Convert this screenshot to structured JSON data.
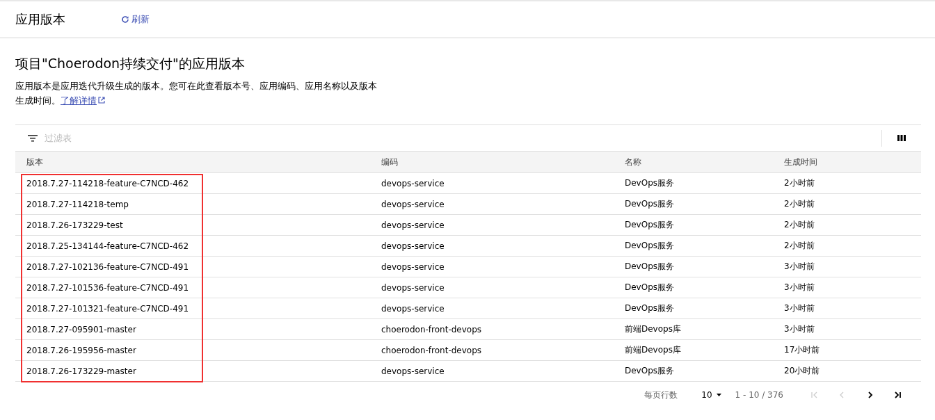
{
  "header": {
    "title": "应用版本",
    "refresh": "刷新"
  },
  "intro": {
    "title": "项目\"Choerodon持续交付\"的应用版本",
    "description": "应用版本是应用迭代升级生成的版本。您可在此查看版本号、应用编码、应用名称以及版本生成时间。",
    "link": "了解详情"
  },
  "filter": {
    "placeholder": "过滤表"
  },
  "table": {
    "columns": [
      "版本",
      "编码",
      "名称",
      "生成时间"
    ],
    "version_column_highlighted": true,
    "rows": [
      [
        "2018.7.27-114218-feature-C7NCD-462",
        "devops-service",
        "DevOps服务",
        "2小时前"
      ],
      [
        "2018.7.27-114218-temp",
        "devops-service",
        "DevOps服务",
        "2小时前"
      ],
      [
        "2018.7.26-173229-test",
        "devops-service",
        "DevOps服务",
        "2小时前"
      ],
      [
        "2018.7.25-134144-feature-C7NCD-462",
        "devops-service",
        "DevOps服务",
        "2小时前"
      ],
      [
        "2018.7.27-102136-feature-C7NCD-491",
        "devops-service",
        "DevOps服务",
        "3小时前"
      ],
      [
        "2018.7.27-101536-feature-C7NCD-491",
        "devops-service",
        "DevOps服务",
        "3小时前"
      ],
      [
        "2018.7.27-101321-feature-C7NCD-491",
        "devops-service",
        "DevOps服务",
        "3小时前"
      ],
      [
        "2018.7.27-095901-master",
        "choerodon-front-devops",
        "前端Devops库",
        "3小时前"
      ],
      [
        "2018.7.26-195956-master",
        "choerodon-front-devops",
        "前端Devops库",
        "17小时前"
      ],
      [
        "2018.7.26-173229-master",
        "devops-service",
        "DevOps服务",
        "20小时前"
      ]
    ]
  },
  "pagination": {
    "rows_label": "每页行数",
    "page_size": "10",
    "range": "1 - 10 / 376",
    "first_disabled": true,
    "prev_disabled": true,
    "next_disabled": false,
    "last_disabled": false
  }
}
